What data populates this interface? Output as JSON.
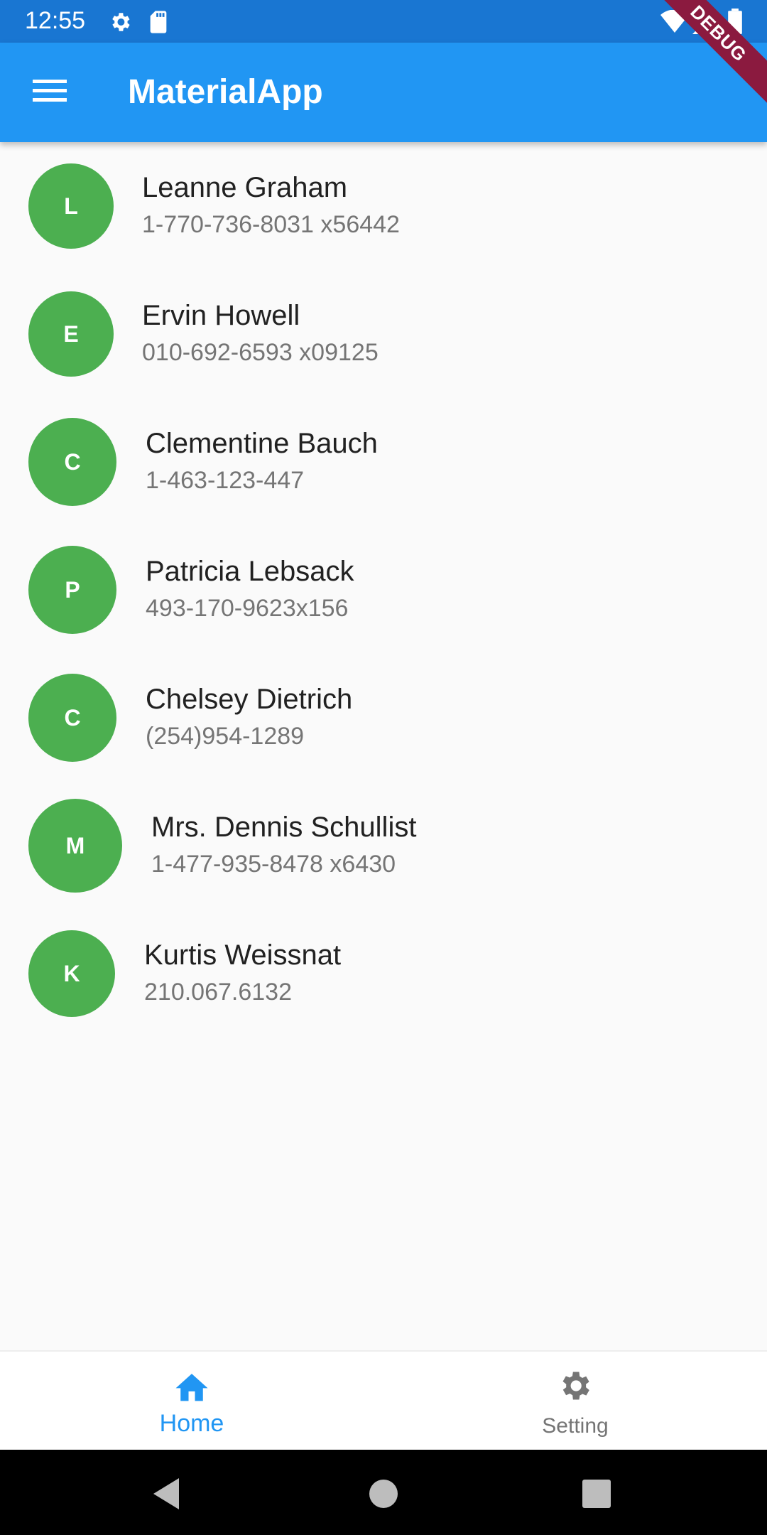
{
  "status_bar": {
    "time": "12:55",
    "icons": [
      "settings-icon",
      "sd-card-icon",
      "wifi-icon",
      "signal-icon",
      "battery-icon"
    ]
  },
  "app_bar": {
    "title": "MaterialApp",
    "menu_icon": "menu-icon",
    "debug_banner": "DEBUG"
  },
  "contacts": [
    {
      "initial": "L",
      "name": "Leanne Graham",
      "phone": "1-770-736-8031 x56442"
    },
    {
      "initial": "E",
      "name": "Ervin Howell",
      "phone": "010-692-6593 x09125"
    },
    {
      "initial": "C",
      "name": "Clementine Bauch",
      "phone": "1-463-123-447"
    },
    {
      "initial": "P",
      "name": "Patricia Lebsack",
      "phone": "493-170-9623x156"
    },
    {
      "initial": "C",
      "name": "Chelsey Dietrich",
      "phone": "(254)954-1289"
    },
    {
      "initial": "M",
      "name": "Mrs. Dennis Schullist",
      "phone": "1-477-935-8478 x6430"
    },
    {
      "initial": "K",
      "name": "Kurtis Weissnat",
      "phone": "210.067.6132"
    }
  ],
  "bottom_nav": {
    "items": [
      {
        "label": "Home",
        "icon": "home-icon",
        "active": true
      },
      {
        "label": "Setting",
        "icon": "gear-icon",
        "active": false
      }
    ]
  },
  "colors": {
    "app_bar": "#2196f3",
    "status_bar": "#1976d2",
    "avatar": "#4caf50",
    "active_nav": "#2196f3",
    "inactive_nav": "#757575",
    "debug_banner": "#8b1a3f"
  }
}
